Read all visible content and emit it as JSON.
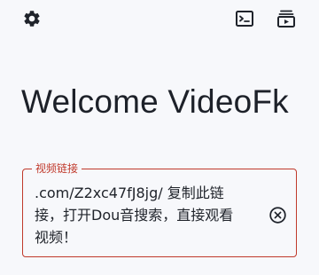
{
  "toolbar": {
    "settings_icon": "gear-icon",
    "terminal_icon": "terminal-icon",
    "library_icon": "video-library-icon"
  },
  "main": {
    "title": "Welcome VideoFk"
  },
  "link_field": {
    "label": "视频链接",
    "value": ".com/Z2xc47fJ8jg/ 复制此链接，打开Dou音搜索，直接观看视频！",
    "clear_icon": "clear-circle-icon"
  },
  "colors": {
    "error": "#c0392b",
    "text": "#1f232b",
    "background": "#f7f8fb"
  }
}
